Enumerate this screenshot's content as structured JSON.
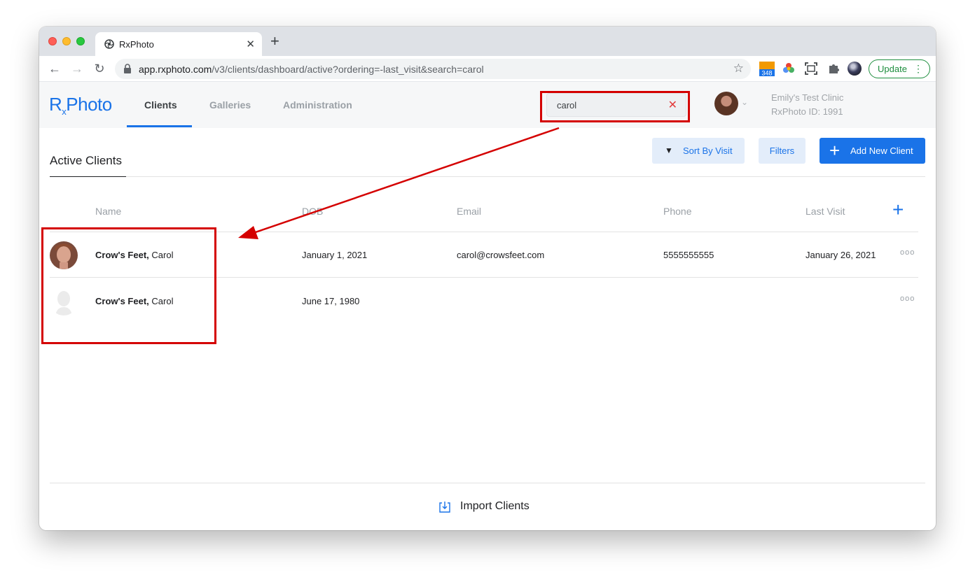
{
  "browser": {
    "tab_title": "RxPhoto",
    "url_host": "app.rxphoto.com",
    "url_path": "/v3/clients/dashboard/active?ordering=-last_visit&search=carol",
    "extension_badge": "348",
    "update_label": "Update"
  },
  "header": {
    "logo_prefix": "R",
    "logo_sub": "x",
    "logo_suffix": "Photo",
    "nav": [
      "Clients",
      "Galleries",
      "Administration"
    ],
    "search_value": "carol",
    "clinic_name": "Emily's Test Clinic",
    "clinic_id": "RxPhoto ID: 1991"
  },
  "main": {
    "title": "Active Clients",
    "sort_label": "Sort By Visit",
    "filters_label": "Filters",
    "add_label": "Add New Client",
    "columns": [
      "Name",
      "DOB",
      "Email",
      "Phone",
      "Last Visit"
    ],
    "rows": [
      {
        "last": "Crow's Feet,",
        "first": " Carol",
        "dob": "January 1, 2021",
        "email": "carol@crowsfeet.com",
        "phone": "5555555555",
        "last_visit": "January 26, 2021"
      },
      {
        "last": "Crow's Feet,",
        "first": " Carol",
        "dob": "June 17, 1980",
        "email": "",
        "phone": "",
        "last_visit": ""
      }
    ],
    "row_menu": "ooo",
    "import_label": "Import Clients"
  },
  "colors": {
    "accent": "#1a73e8",
    "annotation": "#d40000"
  }
}
